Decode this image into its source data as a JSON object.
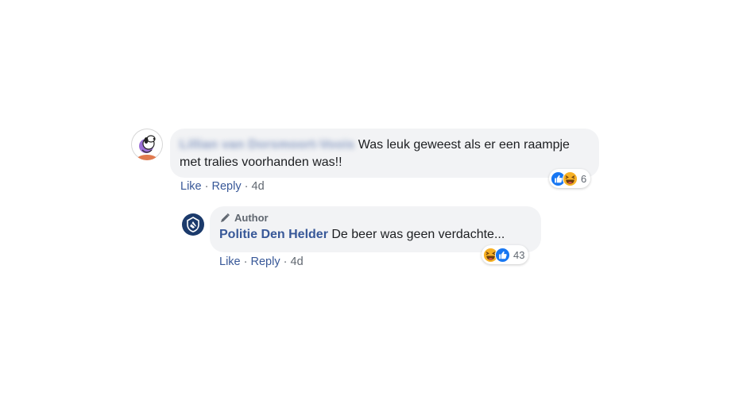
{
  "comment": {
    "author_name": "Lillian van Dorsmoort-Voois",
    "text": "Was leuk geweest als er een raampje met tralies voorhanden was!!",
    "line1": "Was leuk geweest als er een raampje",
    "line2": "met tralies voorhanden was!!",
    "actions": {
      "like": "Like",
      "reply": "Reply",
      "time": "4d",
      "sep": "·"
    },
    "reactions": {
      "icons": [
        "like-icon",
        "haha-icon"
      ],
      "count": "6"
    }
  },
  "reply": {
    "badge": "Author",
    "author_name": "Politie Den Helder",
    "text": "De beer was geen verdachte...",
    "actions": {
      "like": "Like",
      "reply": "Reply",
      "time": "4d",
      "sep": "·"
    },
    "reactions": {
      "icons": [
        "haha-icon",
        "like-icon"
      ],
      "count": "43"
    }
  },
  "colors": {
    "link": "#385898",
    "bubble": "#f2f3f5",
    "meta": "#606770",
    "like_blue": "#1877f2",
    "haha_yellow": "#f7b125",
    "police_navy": "#1b3a6b"
  }
}
